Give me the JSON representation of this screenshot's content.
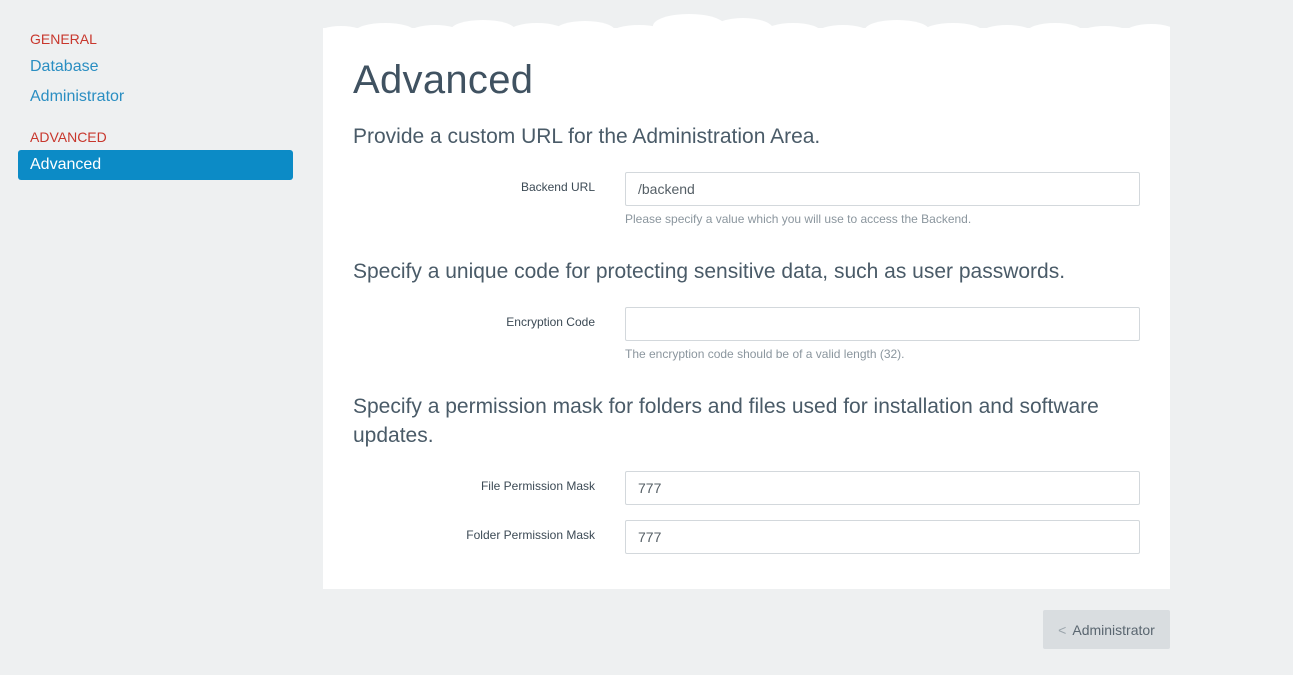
{
  "sidebar": {
    "general_title": "GENERAL",
    "general_items": [
      {
        "label": "Database"
      },
      {
        "label": "Administrator"
      }
    ],
    "advanced_title": "ADVANCED",
    "advanced_items": [
      {
        "label": "Advanced",
        "active": true
      }
    ]
  },
  "main": {
    "title": "Advanced",
    "sections": [
      {
        "description": "Provide a custom URL for the Administration Area.",
        "fields": [
          {
            "label": "Backend URL",
            "value": "/backend",
            "help": "Please specify a value which you will use to access the Backend."
          }
        ]
      },
      {
        "description": "Specify a unique code for protecting sensitive data, such as user passwords.",
        "fields": [
          {
            "label": "Encryption Code",
            "value": "",
            "help": "The encryption code should be of a valid length (32)."
          }
        ]
      },
      {
        "description": "Specify a permission mask for folders and files used for installation and software updates.",
        "fields": [
          {
            "label": "File Permission Mask",
            "value": "777"
          },
          {
            "label": "Folder Permission Mask",
            "value": "777"
          }
        ]
      }
    ]
  },
  "footer": {
    "back_icon": "<",
    "back_label": "Administrator"
  },
  "colors": {
    "accent": "#0c8bc6",
    "section_title": "#c8372d",
    "link": "#2a8ec2",
    "background": "#eef0f1"
  }
}
